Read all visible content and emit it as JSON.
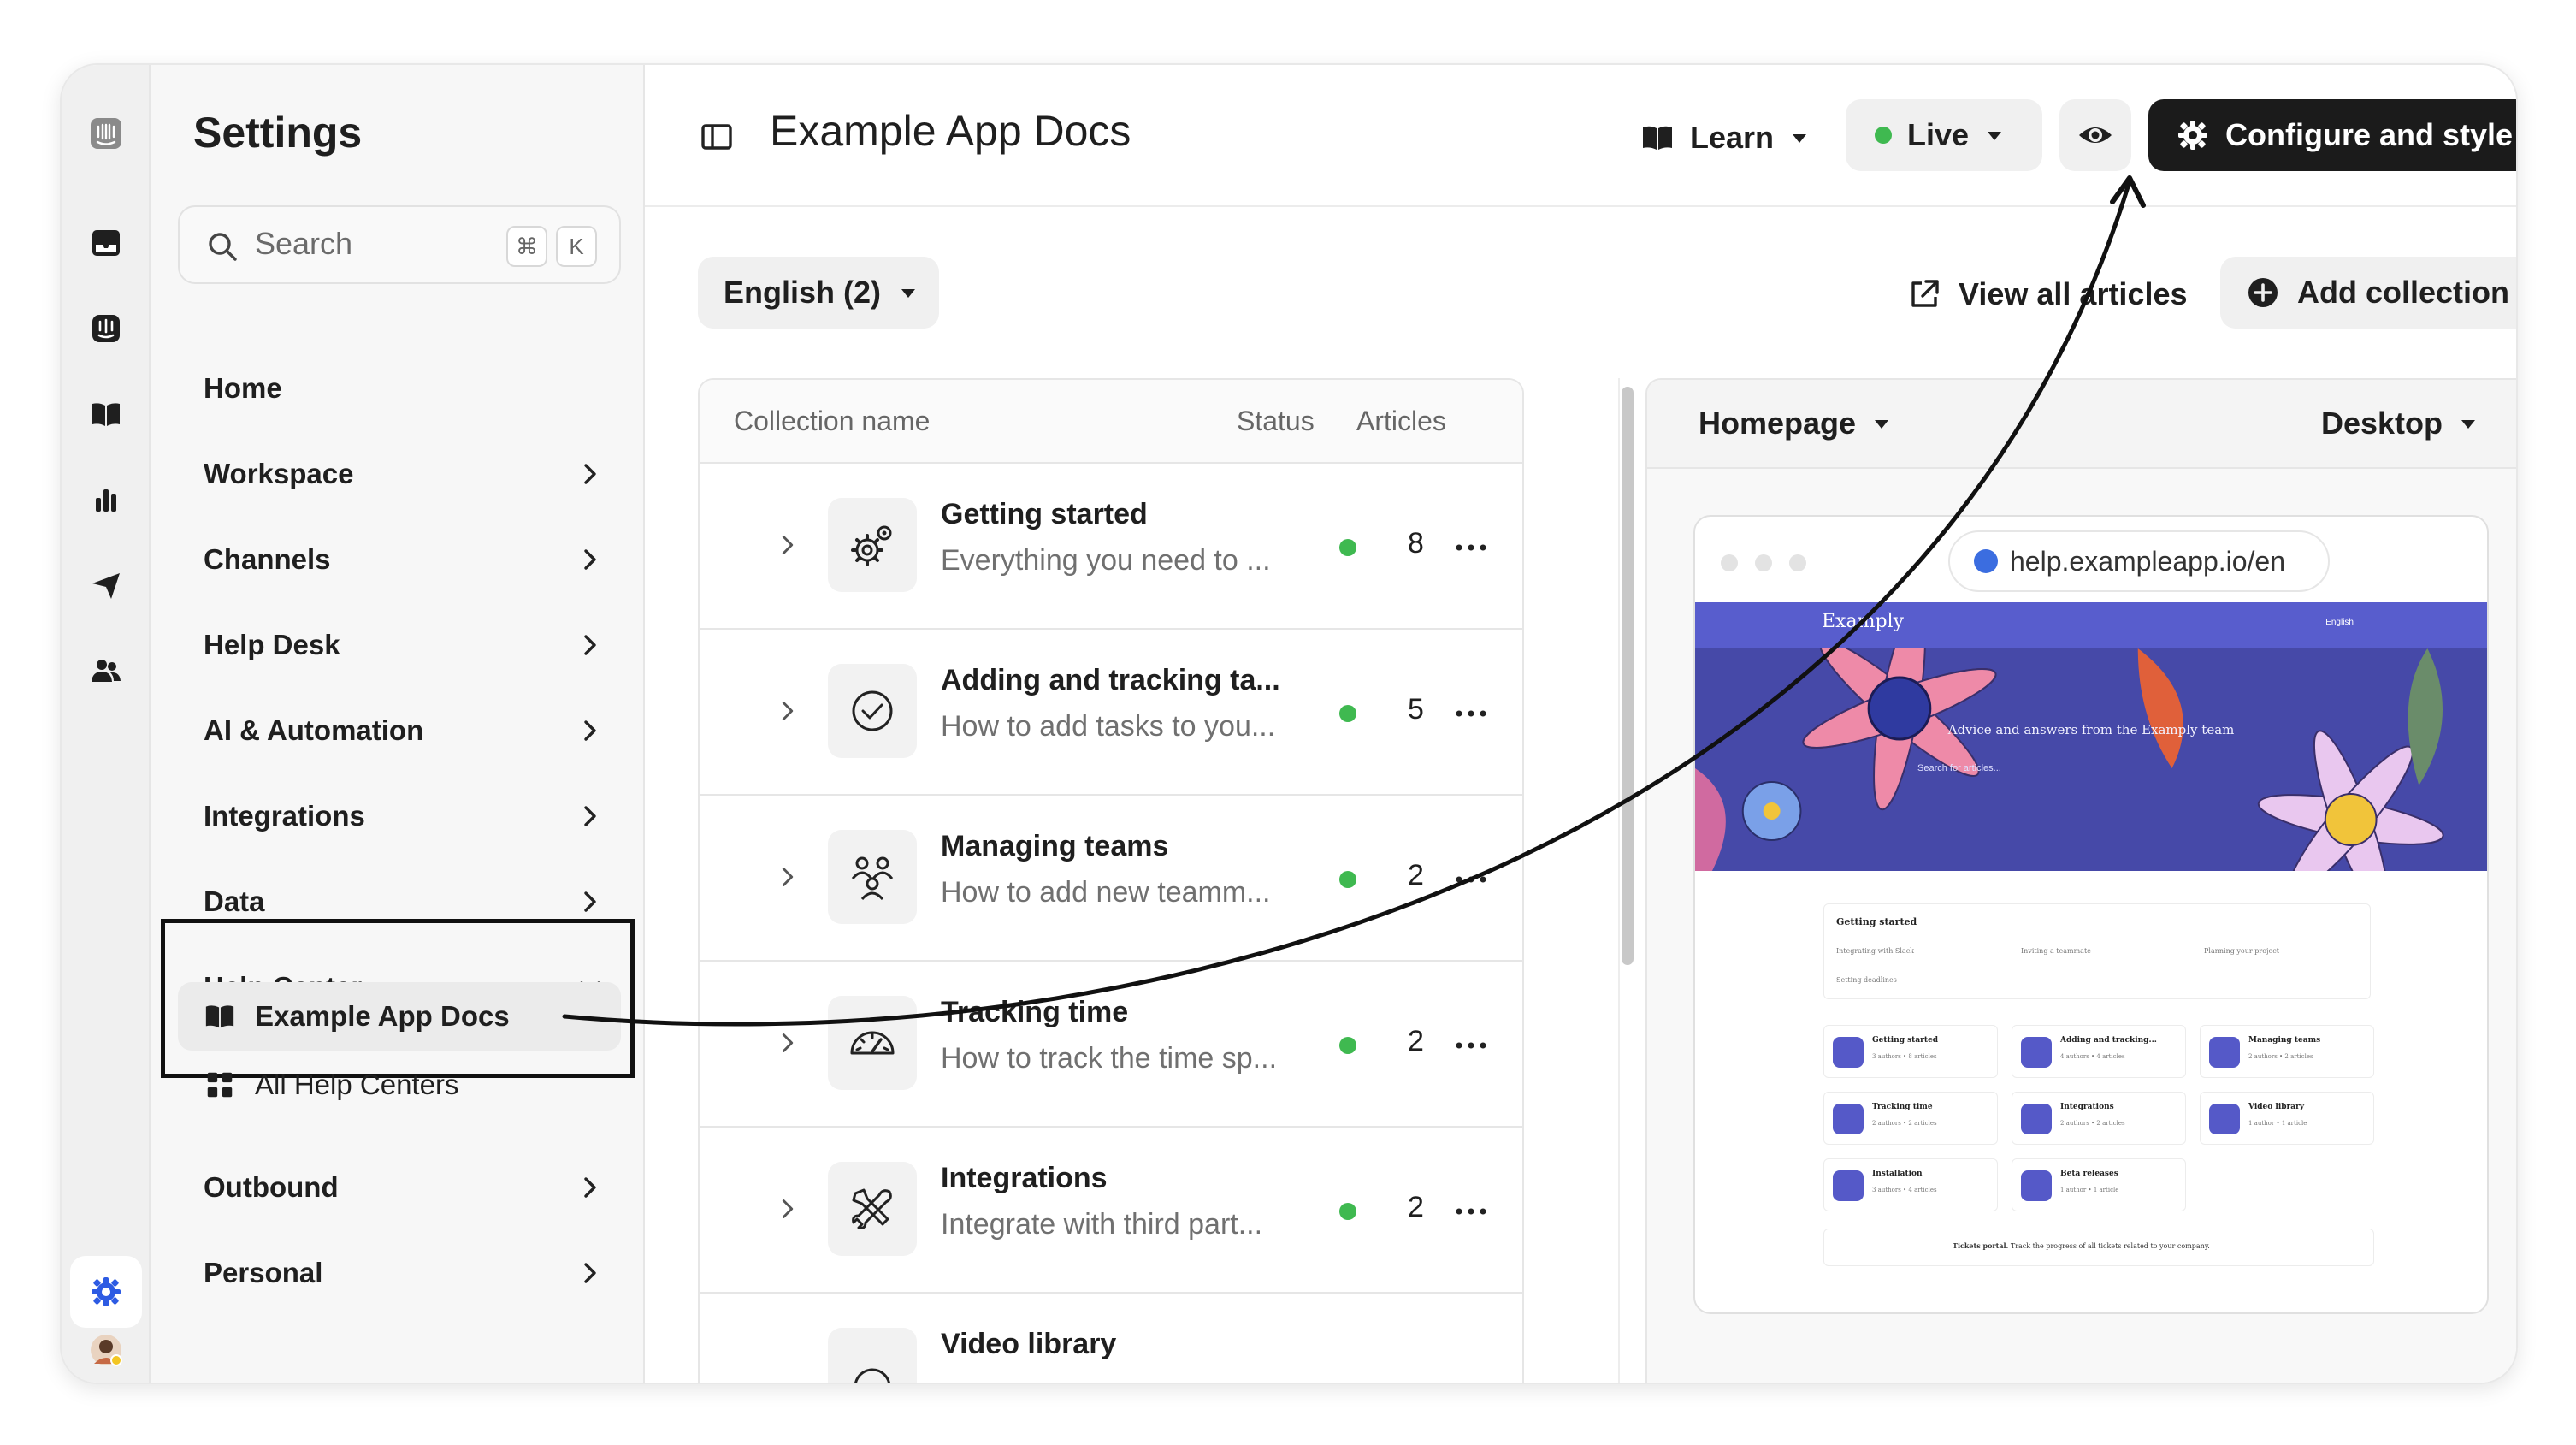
{
  "colors": {
    "accent": "#1b1b1b",
    "status_live": "#3fb950",
    "brand": "#5559c8",
    "rail_active": "#2d5be3"
  },
  "rail": {
    "icons": [
      "intercom-logo-icon",
      "inbox-icon",
      "fin-ai-icon",
      "knowledge-book-icon",
      "reports-chart-icon",
      "outbound-send-icon",
      "contacts-people-icon",
      "settings-gear-icon",
      "avatar"
    ]
  },
  "settings": {
    "title": "Settings",
    "search": {
      "placeholder": "Search",
      "kbd_cmd": "⌘",
      "kbd_k": "K"
    },
    "nav": [
      {
        "label": "Home",
        "has_chevron": false
      },
      {
        "label": "Workspace",
        "has_chevron": true
      },
      {
        "label": "Channels",
        "has_chevron": true
      },
      {
        "label": "Help Desk",
        "has_chevron": true
      },
      {
        "label": "AI & Automation",
        "has_chevron": true
      },
      {
        "label": "Integrations",
        "has_chevron": true
      },
      {
        "label": "Data",
        "has_chevron": true
      },
      {
        "label": "Help Center",
        "has_chevron": true,
        "expanded": true
      },
      {
        "label": "Outbound",
        "has_chevron": true
      },
      {
        "label": "Personal",
        "has_chevron": true
      }
    ],
    "help_center_sub": [
      {
        "label": "Example App Docs",
        "icon": "book-icon",
        "active": true
      },
      {
        "label": "All Help Centers",
        "icon": "grid-icon",
        "active": false
      }
    ]
  },
  "header": {
    "title": "Example App Docs",
    "learn_label": "Learn",
    "live_label": "Live",
    "configure_label": "Configure and style"
  },
  "toolbar": {
    "language_label": "English (2)",
    "view_all_label": "View all articles",
    "add_collection_label": "Add collection"
  },
  "table": {
    "columns": [
      "Collection name",
      "Status",
      "Articles"
    ],
    "rows": [
      {
        "title": "Getting started",
        "desc": "Everything you need to ...",
        "count": "8",
        "icon": "gears-icon"
      },
      {
        "title": "Adding and tracking ta...",
        "desc": "How to add tasks to you...",
        "count": "5",
        "icon": "check-circle-icon"
      },
      {
        "title": "Managing teams",
        "desc": "How to add new teamm...",
        "count": "2",
        "icon": "team-icon"
      },
      {
        "title": "Tracking time",
        "desc": "How to track the time sp...",
        "count": "2",
        "icon": "gauge-icon"
      },
      {
        "title": "Integrations",
        "desc": "Integrate with third part...",
        "count": "2",
        "icon": "tools-icon"
      },
      {
        "title": "Video library",
        "desc": "",
        "count": "",
        "icon": "video-icon"
      }
    ]
  },
  "preview": {
    "page_select": "Homepage",
    "device_select": "Desktop",
    "url": "help.exampleapp.io/en",
    "brand": "Examply",
    "hero_lang": "English",
    "tagline": "Advice and answers from the Examply team",
    "search_placeholder": "Search for articles...",
    "featured": {
      "title": "Getting started",
      "links": [
        "Integrating with Slack",
        "Inviting a teammate",
        "Planning your project",
        "Setting deadlines"
      ]
    },
    "cards": [
      {
        "title": "Getting started",
        "meta": "3 authors • 8 articles"
      },
      {
        "title": "Adding and tracking...",
        "meta": "4 authors • 4 articles"
      },
      {
        "title": "Managing teams",
        "meta": "2 authors • 2 articles"
      },
      {
        "title": "Tracking time",
        "meta": "2 authors • 2 articles"
      },
      {
        "title": "Integrations",
        "meta": "2 authors • 2 articles"
      },
      {
        "title": "Video library",
        "meta": "1 author • 1 article"
      },
      {
        "title": "Installation",
        "meta": "3 authors • 4 articles"
      },
      {
        "title": "Beta releases",
        "meta": "1 author • 1 article"
      }
    ],
    "tickets_bold": "Tickets portal.",
    "tickets_text": "Track the progress of all tickets related to your company."
  }
}
